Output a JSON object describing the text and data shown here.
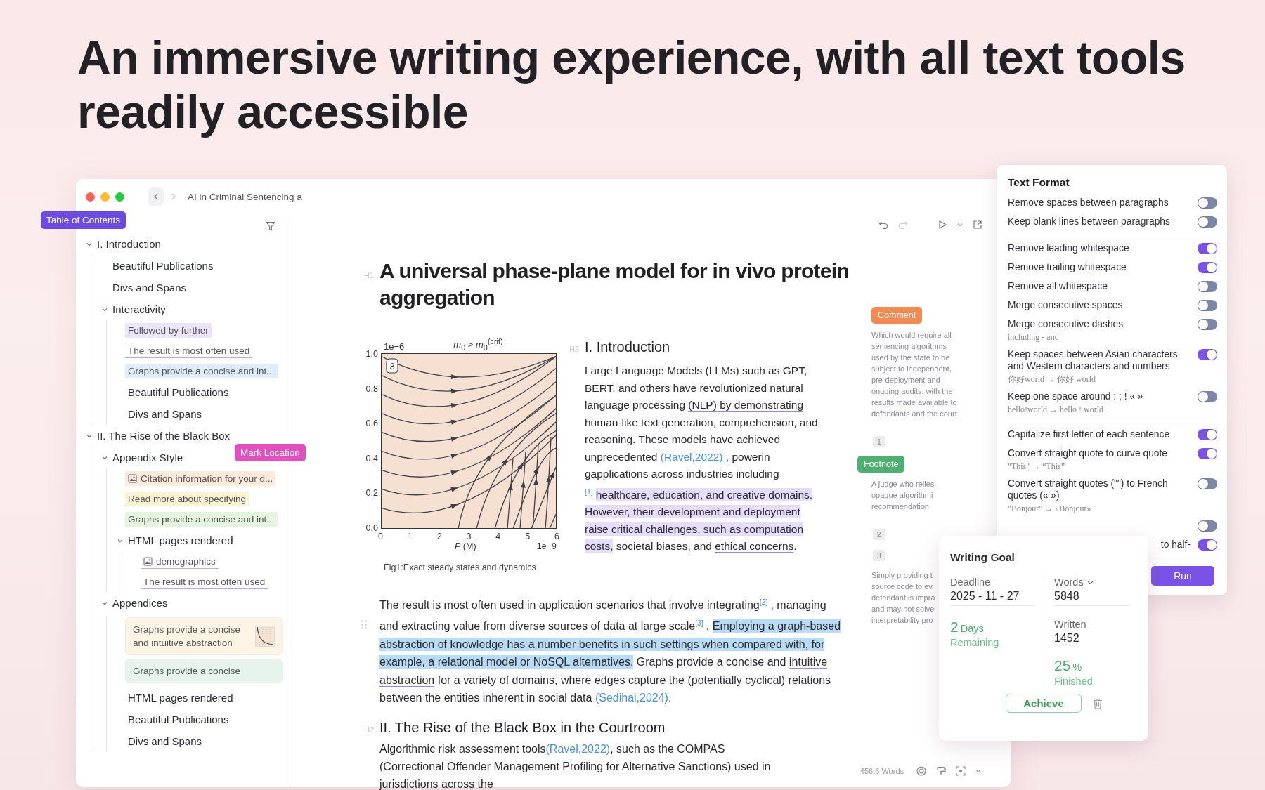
{
  "headline": "An immersive writing experience, with all text tools readily accessible",
  "window": {
    "breadcrumb": "AI in Criminal Sentencing a",
    "sidebar": {
      "callout": "Table of Contents",
      "items": [
        {
          "label": "I. Introduction",
          "expanded": true,
          "children": [
            {
              "label": "Beautiful Publications",
              "kind": "plain"
            },
            {
              "label": "Divs and Spans",
              "kind": "plain"
            },
            {
              "label": "Interactivity",
              "expanded": true,
              "children": [
                {
                  "label": "Followed by further",
                  "kind": "highlight",
                  "color": "#ece5fb"
                },
                {
                  "label": "The result is most often used",
                  "kind": "underline",
                  "color": "#b9a9ec"
                },
                {
                  "label": "Graphs provide a concise and int...",
                  "kind": "highlight",
                  "color": "#dfedfb"
                },
                {
                  "label": "Beautiful Publications",
                  "kind": "plain"
                },
                {
                  "label": "Divs and Spans",
                  "kind": "plain"
                }
              ]
            }
          ]
        },
        {
          "label": "II. The Rise of the Black Box",
          "expanded": true,
          "children": [
            {
              "label": "Appendix Style",
              "expanded": true,
              "callout": "Mark Location",
              "children": [
                {
                  "label": "Citation information for your d...",
                  "kind": "highlight",
                  "color": "#fdeadb",
                  "image": true
                },
                {
                  "label": "Read more about specifying",
                  "kind": "highlight",
                  "color": "#fcf3d5"
                },
                {
                  "label": "Graphs provide a concise and int...",
                  "kind": "highlight",
                  "color": "#e5f5de"
                },
                {
                  "label": "HTML pages rendered",
                  "expanded": true,
                  "children": [
                    {
                      "label": "demographics",
                      "kind": "underline",
                      "color": "#b9a9ec",
                      "image": true
                    },
                    {
                      "label": "The result is most often used",
                      "kind": "underline",
                      "color": "#b9a9ec"
                    }
                  ]
                }
              ]
            },
            {
              "label": "Appendices",
              "expanded": true,
              "children": [
                {
                  "label": "Graphs provide a concise and intuitive abstraction",
                  "kind": "card",
                  "color": "#fdf4e6",
                  "thumbnail": true
                },
                {
                  "label": "Graphs provide a concise",
                  "kind": "card",
                  "color": "#e7f4ee"
                },
                {
                  "label": "HTML pages rendered",
                  "kind": "plain"
                },
                {
                  "label": "Beautiful Publications",
                  "kind": "plain"
                },
                {
                  "label": "Divs and Spans",
                  "kind": "plain"
                }
              ]
            }
          ]
        }
      ]
    },
    "editor": {
      "title": {
        "tag": "H1",
        "text": "A universal phase-plane model for in vivo protein aggregation"
      },
      "figure": {
        "title": "*m*$_{0}$ > *m*$_{0}$$^{(crit)}$",
        "y_scale": "1e−6",
        "x_scale": "1e−9",
        "panel_label": "3",
        "x_ticks": [
          "0",
          "1",
          "2",
          "3",
          "4",
          "5",
          "6"
        ],
        "y_ticks": [
          "1.0",
          "0.8",
          "0.6",
          "0.4",
          "0.2",
          "0.0"
        ],
        "x_label": "*P* (M)",
        "caption": "Fig1:Exact steady states and dynamics"
      },
      "intro": {
        "tag": "H2",
        "heading": "I. Introduction",
        "segments": [
          {
            "kind": "plain",
            "text": "Large Language Models (LLMs) such as GPT, BERT, and others have revolutionized natural language processing "
          },
          {
            "kind": "underline",
            "text": "(NLP) by demonstrating"
          },
          {
            "kind": "plain",
            "text": " human-like text generation, comprehension, and reasoning. These models have achieved unprecedented "
          },
          {
            "kind": "link",
            "text": "(Ravel,2022)"
          },
          {
            "kind": "plain",
            "text": " , powerin gapplications across industries including "
          },
          {
            "kind": "footnote",
            "text": "[1]"
          },
          {
            "kind": "highlight",
            "color": "#e6dcfb",
            "text": "healthcare, education, and creative domains. However, their development and deployment raise critical challenges, such as computation costs,"
          },
          {
            "kind": "plain",
            "text": " societal biases, and "
          },
          {
            "kind": "underline",
            "text": "ethical concerns"
          },
          {
            "kind": "plain",
            "text": "."
          }
        ]
      },
      "paragraph": {
        "segments": [
          {
            "kind": "plain",
            "text": "The result is most often used in application scenarios that involve integrating"
          },
          {
            "kind": "footnote",
            "text": "[2]"
          },
          {
            "kind": "plain",
            "text": ", managing and extracting value from diverse sources of data at large scale"
          },
          {
            "kind": "footnote",
            "text": "[3]"
          },
          {
            "kind": "plain",
            "text": ". "
          },
          {
            "kind": "highlight",
            "color": "#b9dbf5",
            "text": "Employing a graph-based abstraction of knowledge has a number benefits in such settings when compared with, for example, a relational model or NoSQL alternatives."
          },
          {
            "kind": "plain",
            "text": " Graphs provide a concise and "
          },
          {
            "kind": "underline",
            "text": "intuitive abstraction"
          },
          {
            "kind": "plain",
            "text": " for a variety of domains, where edges capture the (potentially cyclical) relations between the entities inherent in social data "
          },
          {
            "kind": "link",
            "text": "(Sedihai,2024)"
          },
          {
            "kind": "plain",
            "text": "."
          }
        ]
      },
      "section2": {
        "tag": "H2",
        "heading": "II. The Rise of the Black Box in the Courtroom",
        "segments": [
          {
            "kind": "plain",
            "text": "Algorithmic risk assessment tools"
          },
          {
            "kind": "link",
            "text": "(Ravel,2022)"
          },
          {
            "kind": "plain",
            "text": ", such as the COMPAS (Correctional Offender Management Profiling for Alternative Sanctions) used in jurisdictions across the"
          }
        ]
      }
    },
    "margin": [
      {
        "kind": "note",
        "tag": "Comment",
        "color": "#f28a52",
        "lines": [
          "Which would require all sentencing algorithms used by the state to be subject to independent, pre-deployment and ongoing audits, with the results made available to defendants and the court."
        ]
      },
      {
        "kind": "marker",
        "label": "1"
      },
      {
        "kind": "note",
        "tag": "Footnote",
        "color": "#4fae70",
        "lines": [
          "A judge who relies",
          "opaque algorithmi",
          "recommendation"
        ]
      },
      {
        "kind": "marker",
        "label": "2"
      },
      {
        "kind": "marker",
        "label": "3"
      },
      {
        "kind": "note",
        "lines": [
          "Simply providing t",
          "source code to ev",
          "defendant is impra",
          "and may not solve",
          "interpretability pro"
        ]
      }
    ],
    "status_bar": {
      "word_count": "456,6 Words"
    }
  },
  "text_format": {
    "title": "Text Format",
    "groups": [
      {
        "items": [
          {
            "label": "Remove spaces between paragraphs",
            "on": false
          },
          {
            "label": "Keep blank lines between paragraphs",
            "on": false
          }
        ]
      },
      {
        "items": [
          {
            "label": "Remove leading whitespace",
            "on": true
          },
          {
            "label": "Remove trailing whitespace",
            "on": true
          },
          {
            "label": "Remove all whitespace",
            "on": false
          },
          {
            "label": "Merge consecutive spaces",
            "on": false
          },
          {
            "label": "Merge consecutive dashes",
            "hint": "including - and ——",
            "on": false
          },
          {
            "label": "Keep spaces between Asian characters and Western characters and numbers",
            "hint": "你好world → 你好 world",
            "on": true
          },
          {
            "label": "Keep one space around : ; ! « »",
            "hint": "hello!world → hello ! world",
            "on": false
          }
        ]
      },
      {
        "items": [
          {
            "label": "Capitalize first letter of each sentence",
            "on": true
          },
          {
            "label": "Convert straight quote to curve quote",
            "hint": "\"This\" → “This”",
            "on": true
          },
          {
            "label": "Convert straight quotes (\"\") to French quotes (« »)",
            "hint": "\"Bonjour\" → «Bonjour»",
            "on": false
          },
          {
            "on": false
          },
          {
            "label": "to half-",
            "covered": true,
            "on": true
          }
        ]
      }
    ],
    "run_button": "Run"
  },
  "writing_goal": {
    "title": "Writing Goal",
    "deadline": {
      "label": "Deadline",
      "value": "2025 - 11 - 27"
    },
    "remaining": {
      "number": "2",
      "unit": "Days",
      "label": "Remaining"
    },
    "target": {
      "label": "Words",
      "value": "5848"
    },
    "written": {
      "label": "Written",
      "value": "1452"
    },
    "progress": {
      "number": "25",
      "unit": "%",
      "label": "Finished"
    },
    "button": "Achieve"
  }
}
